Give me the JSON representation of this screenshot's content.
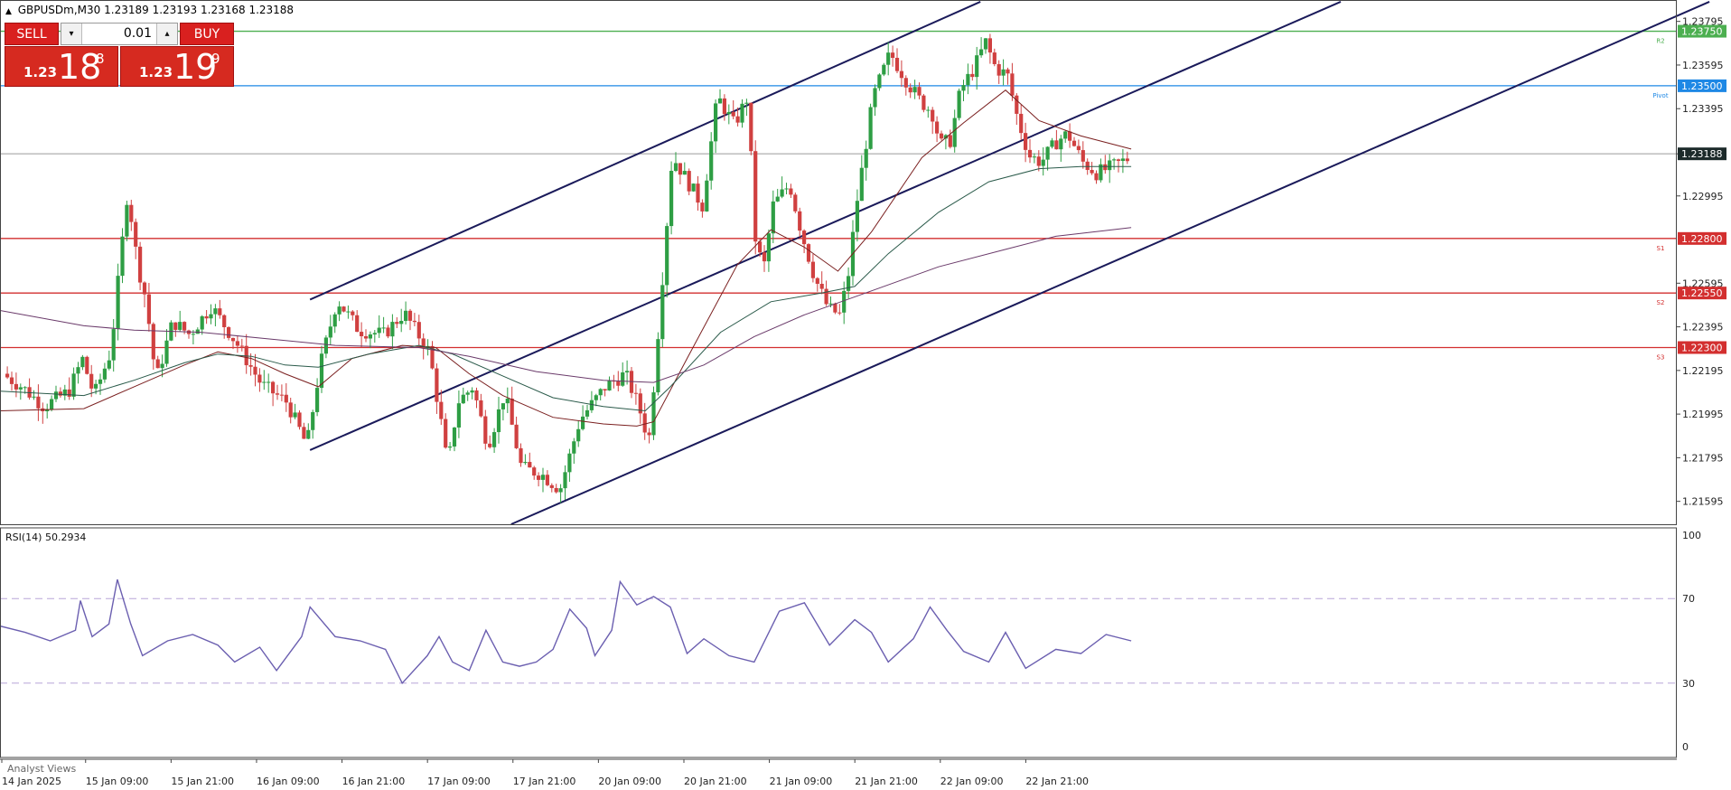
{
  "header": {
    "caret": "▲",
    "symbol": "GBPUSDm,M30",
    "ohlc": "1.23189 1.23193 1.23168 1.23188"
  },
  "trade_panel": {
    "sell_label": "SELL",
    "buy_label": "BUY",
    "lot_value": "0.01",
    "down_arrow": "▾",
    "up_arrow": "▴",
    "sell_price_prefix": "1.23",
    "sell_price_big": "18",
    "sell_price_sup": "8",
    "buy_price_prefix": "1.23",
    "buy_price_big": "19",
    "buy_price_sup": "9"
  },
  "rsi_label": "RSI(14) 50.2934",
  "analyst_views_label": "Analyst Views",
  "colors": {
    "bull_candle": "#2e9e44",
    "bear_candle": "#d04040",
    "channel": "#1a1a5a",
    "rsi_line": "#6b5fb0",
    "resistance": "#4caf50",
    "pivot": "#1e88e5",
    "support": "#d32f2f",
    "current_price_bg": "#1c2a2a"
  },
  "chart_data": [
    {
      "type": "candlestick",
      "title": "",
      "ylim": [
        1.2149,
        1.2386
      ],
      "y_ticks": [
        "1.23795",
        "1.23595",
        "1.23395",
        "1.23188",
        "1.22995",
        "1.22595",
        "1.22395",
        "1.22195",
        "1.21995",
        "1.21795",
        "1.21595"
      ],
      "y_tick_values": [
        1.23795,
        1.23595,
        1.23395,
        1.23188,
        1.22995,
        1.22595,
        1.22395,
        1.22195,
        1.21995,
        1.21795,
        1.21595
      ],
      "x_ticks": [
        "14 Jan 2025",
        "15 Jan 09:00",
        "15 Jan 21:00",
        "16 Jan 09:00",
        "16 Jan 21:00",
        "17 Jan 09:00",
        "17 Jan 21:00",
        "20 Jan 09:00",
        "20 Jan 21:00",
        "21 Jan 09:00",
        "21 Jan 21:00",
        "22 Jan 09:00",
        "22 Jan 21:00"
      ],
      "current_price": {
        "value": 1.23188,
        "label": "1.23188"
      },
      "levels": [
        {
          "name": "R2",
          "value": 1.2375,
          "label": "1.23750",
          "color": "#4caf50"
        },
        {
          "name": "Pivot",
          "value": 1.235,
          "label": "1.23500",
          "color": "#1e88e5"
        },
        {
          "name": "S1",
          "value": 1.228,
          "label": "1.22800",
          "color": "#d32f2f"
        },
        {
          "name": "S2",
          "value": 1.2255,
          "label": "1.22550",
          "color": "#d32f2f"
        },
        {
          "name": "S3",
          "value": 1.223,
          "label": "1.22300",
          "color": "#d32f2f"
        }
      ],
      "channel_lines": [
        {
          "start": {
            "bar": 0.185,
            "price": 1.2252
          },
          "end": {
            "bar": 0.585,
            "price": 1.23885
          }
        },
        {
          "start": {
            "bar": 0.185,
            "price": 1.2183
          },
          "end": {
            "bar": 0.8,
            "price": 1.23885
          }
        },
        {
          "start": {
            "bar": 0.305,
            "price": 1.2149
          },
          "end": {
            "bar": 1.02,
            "price": 1.23885
          }
        }
      ],
      "keypoints": [
        [
          0,
          1.2218
        ],
        [
          0.012,
          1.2212
        ],
        [
          0.025,
          1.2203
        ],
        [
          0.04,
          1.221
        ],
        [
          0.048,
          1.2225
        ],
        [
          0.055,
          1.2208
        ],
        [
          0.065,
          1.2228
        ],
        [
          0.075,
          1.2302
        ],
        [
          0.081,
          1.2268
        ],
        [
          0.086,
          1.2252
        ],
        [
          0.092,
          1.2215
        ],
        [
          0.102,
          1.2242
        ],
        [
          0.112,
          1.2236
        ],
        [
          0.125,
          1.2249
        ],
        [
          0.14,
          1.2232
        ],
        [
          0.155,
          1.2213
        ],
        [
          0.17,
          1.2205
        ],
        [
          0.182,
          1.2185
        ],
        [
          0.19,
          1.2222
        ],
        [
          0.2,
          1.2252
        ],
        [
          0.213,
          1.2238
        ],
        [
          0.228,
          1.2236
        ],
        [
          0.24,
          1.2246
        ],
        [
          0.255,
          1.2228
        ],
        [
          0.262,
          1.2196
        ],
        [
          0.266,
          1.2175
        ],
        [
          0.272,
          1.2205
        ],
        [
          0.281,
          1.2212
        ],
        [
          0.29,
          1.2185
        ],
        [
          0.3,
          1.2209
        ],
        [
          0.31,
          1.2175
        ],
        [
          0.322,
          1.2172
        ],
        [
          0.333,
          1.2165
        ],
        [
          0.345,
          1.2197
        ],
        [
          0.36,
          1.2212
        ],
        [
          0.372,
          1.2218
        ],
        [
          0.38,
          1.2203
        ],
        [
          0.386,
          1.2187
        ],
        [
          0.39,
          1.2222
        ],
        [
          0.4,
          1.2318
        ],
        [
          0.41,
          1.2305
        ],
        [
          0.418,
          1.2295
        ],
        [
          0.427,
          1.2345
        ],
        [
          0.437,
          1.2332
        ],
        [
          0.445,
          1.2345
        ],
        [
          0.45,
          1.2275
        ],
        [
          0.455,
          1.2268
        ],
        [
          0.46,
          1.2295
        ],
        [
          0.47,
          1.2305
        ],
        [
          0.477,
          1.2283
        ],
        [
          0.485,
          1.2262
        ],
        [
          0.493,
          1.2248
        ],
        [
          0.5,
          1.2245
        ],
        [
          0.505,
          1.2263
        ],
        [
          0.51,
          1.2296
        ],
        [
          0.52,
          1.2345
        ],
        [
          0.53,
          1.2365
        ],
        [
          0.54,
          1.2352
        ],
        [
          0.548,
          1.2343
        ],
        [
          0.555,
          1.2338
        ],
        [
          0.56,
          1.2323
        ],
        [
          0.566,
          1.2325
        ],
        [
          0.572,
          1.2348
        ],
        [
          0.58,
          1.2358
        ],
        [
          0.587,
          1.237
        ],
        [
          0.593,
          1.2358
        ],
        [
          0.6,
          1.2355
        ],
        [
          0.606,
          1.2335
        ],
        [
          0.613,
          1.2318
        ],
        [
          0.62,
          1.2315
        ],
        [
          0.63,
          1.2325
        ],
        [
          0.636,
          1.2328
        ],
        [
          0.645,
          1.2315
        ],
        [
          0.653,
          1.231
        ],
        [
          0.66,
          1.2312
        ],
        [
          0.668,
          1.2315
        ],
        [
          0.675,
          1.2318
        ]
      ],
      "moving_averages": [
        {
          "color": "#7a1f1f",
          "points": [
            [
              0,
              1.2201
            ],
            [
              0.05,
              1.2202
            ],
            [
              0.08,
              1.2212
            ],
            [
              0.11,
              1.2222
            ],
            [
              0.13,
              1.2228
            ],
            [
              0.15,
              1.2225
            ],
            [
              0.17,
              1.2218
            ],
            [
              0.19,
              1.2212
            ],
            [
              0.21,
              1.2225
            ],
            [
              0.24,
              1.2231
            ],
            [
              0.26,
              1.223
            ],
            [
              0.28,
              1.2218
            ],
            [
              0.3,
              1.2208
            ],
            [
              0.33,
              1.2198
            ],
            [
              0.36,
              1.2195
            ],
            [
              0.38,
              1.2194
            ],
            [
              0.39,
              1.2196
            ],
            [
              0.41,
              1.2225
            ],
            [
              0.44,
              1.2268
            ],
            [
              0.46,
              1.2284
            ],
            [
              0.48,
              1.2276
            ],
            [
              0.5,
              1.2265
            ],
            [
              0.52,
              1.2283
            ],
            [
              0.55,
              1.2317
            ],
            [
              0.575,
              1.2333
            ],
            [
              0.6,
              1.2348
            ],
            [
              0.62,
              1.2334
            ],
            [
              0.645,
              1.2327
            ],
            [
              0.675,
              1.2321
            ]
          ]
        },
        {
          "color": "#2a5a4a",
          "points": [
            [
              0,
              1.221
            ],
            [
              0.05,
              1.2208
            ],
            [
              0.08,
              1.2215
            ],
            [
              0.11,
              1.2223
            ],
            [
              0.13,
              1.2227
            ],
            [
              0.15,
              1.2226
            ],
            [
              0.17,
              1.2222
            ],
            [
              0.19,
              1.2221
            ],
            [
              0.22,
              1.2227
            ],
            [
              0.25,
              1.2231
            ],
            [
              0.27,
              1.2227
            ],
            [
              0.3,
              1.2217
            ],
            [
              0.33,
              1.2207
            ],
            [
              0.36,
              1.2203
            ],
            [
              0.385,
              1.2201
            ],
            [
              0.4,
              1.2212
            ],
            [
              0.43,
              1.2237
            ],
            [
              0.46,
              1.2251
            ],
            [
              0.49,
              1.2255
            ],
            [
              0.51,
              1.2258
            ],
            [
              0.53,
              1.2273
            ],
            [
              0.56,
              1.2292
            ],
            [
              0.59,
              1.2306
            ],
            [
              0.62,
              1.2312
            ],
            [
              0.645,
              1.2313
            ],
            [
              0.675,
              1.2313
            ]
          ]
        },
        {
          "color": "#6a3a6a",
          "points": [
            [
              0,
              1.2247
            ],
            [
              0.05,
              1.224
            ],
            [
              0.08,
              1.2238
            ],
            [
              0.12,
              1.2237
            ],
            [
              0.16,
              1.2234
            ],
            [
              0.2,
              1.2231
            ],
            [
              0.25,
              1.223
            ],
            [
              0.28,
              1.2226
            ],
            [
              0.32,
              1.2219
            ],
            [
              0.36,
              1.2215
            ],
            [
              0.39,
              1.2214
            ],
            [
              0.42,
              1.2222
            ],
            [
              0.45,
              1.2235
            ],
            [
              0.48,
              1.2245
            ],
            [
              0.52,
              1.2256
            ],
            [
              0.56,
              1.2267
            ],
            [
              0.6,
              1.2275
            ],
            [
              0.63,
              1.2281
            ],
            [
              0.675,
              1.2285
            ]
          ]
        }
      ]
    },
    {
      "type": "line",
      "title": "",
      "series_label": "RSI(14) 50.2934",
      "ylim": [
        0,
        100
      ],
      "y_ticks": [
        100,
        70,
        30,
        0
      ],
      "levels": [
        70,
        30
      ],
      "points": [
        [
          0,
          57
        ],
        [
          0.015,
          54
        ],
        [
          0.03,
          50
        ],
        [
          0.045,
          55
        ],
        [
          0.048,
          69
        ],
        [
          0.055,
          52
        ],
        [
          0.065,
          58
        ],
        [
          0.07,
          79
        ],
        [
          0.078,
          58
        ],
        [
          0.085,
          43
        ],
        [
          0.1,
          50
        ],
        [
          0.115,
          53
        ],
        [
          0.13,
          48
        ],
        [
          0.14,
          40
        ],
        [
          0.155,
          47
        ],
        [
          0.165,
          36
        ],
        [
          0.18,
          52
        ],
        [
          0.185,
          66
        ],
        [
          0.2,
          52
        ],
        [
          0.215,
          50
        ],
        [
          0.23,
          46
        ],
        [
          0.24,
          30
        ],
        [
          0.255,
          43
        ],
        [
          0.262,
          52
        ],
        [
          0.27,
          40
        ],
        [
          0.28,
          36
        ],
        [
          0.29,
          55
        ],
        [
          0.3,
          40
        ],
        [
          0.31,
          38
        ],
        [
          0.32,
          40
        ],
        [
          0.33,
          46
        ],
        [
          0.34,
          65
        ],
        [
          0.35,
          56
        ],
        [
          0.355,
          43
        ],
        [
          0.365,
          55
        ],
        [
          0.37,
          78
        ],
        [
          0.38,
          67
        ],
        [
          0.39,
          71
        ],
        [
          0.4,
          66
        ],
        [
          0.41,
          44
        ],
        [
          0.42,
          51
        ],
        [
          0.435,
          43
        ],
        [
          0.45,
          40
        ],
        [
          0.465,
          64
        ],
        [
          0.48,
          68
        ],
        [
          0.495,
          48
        ],
        [
          0.51,
          60
        ],
        [
          0.52,
          54
        ],
        [
          0.53,
          40
        ],
        [
          0.545,
          51
        ],
        [
          0.555,
          66
        ],
        [
          0.565,
          55
        ],
        [
          0.575,
          45
        ],
        [
          0.59,
          40
        ],
        [
          0.6,
          54
        ],
        [
          0.612,
          37
        ],
        [
          0.63,
          46
        ],
        [
          0.645,
          44
        ],
        [
          0.66,
          53
        ],
        [
          0.675,
          50
        ]
      ]
    }
  ]
}
